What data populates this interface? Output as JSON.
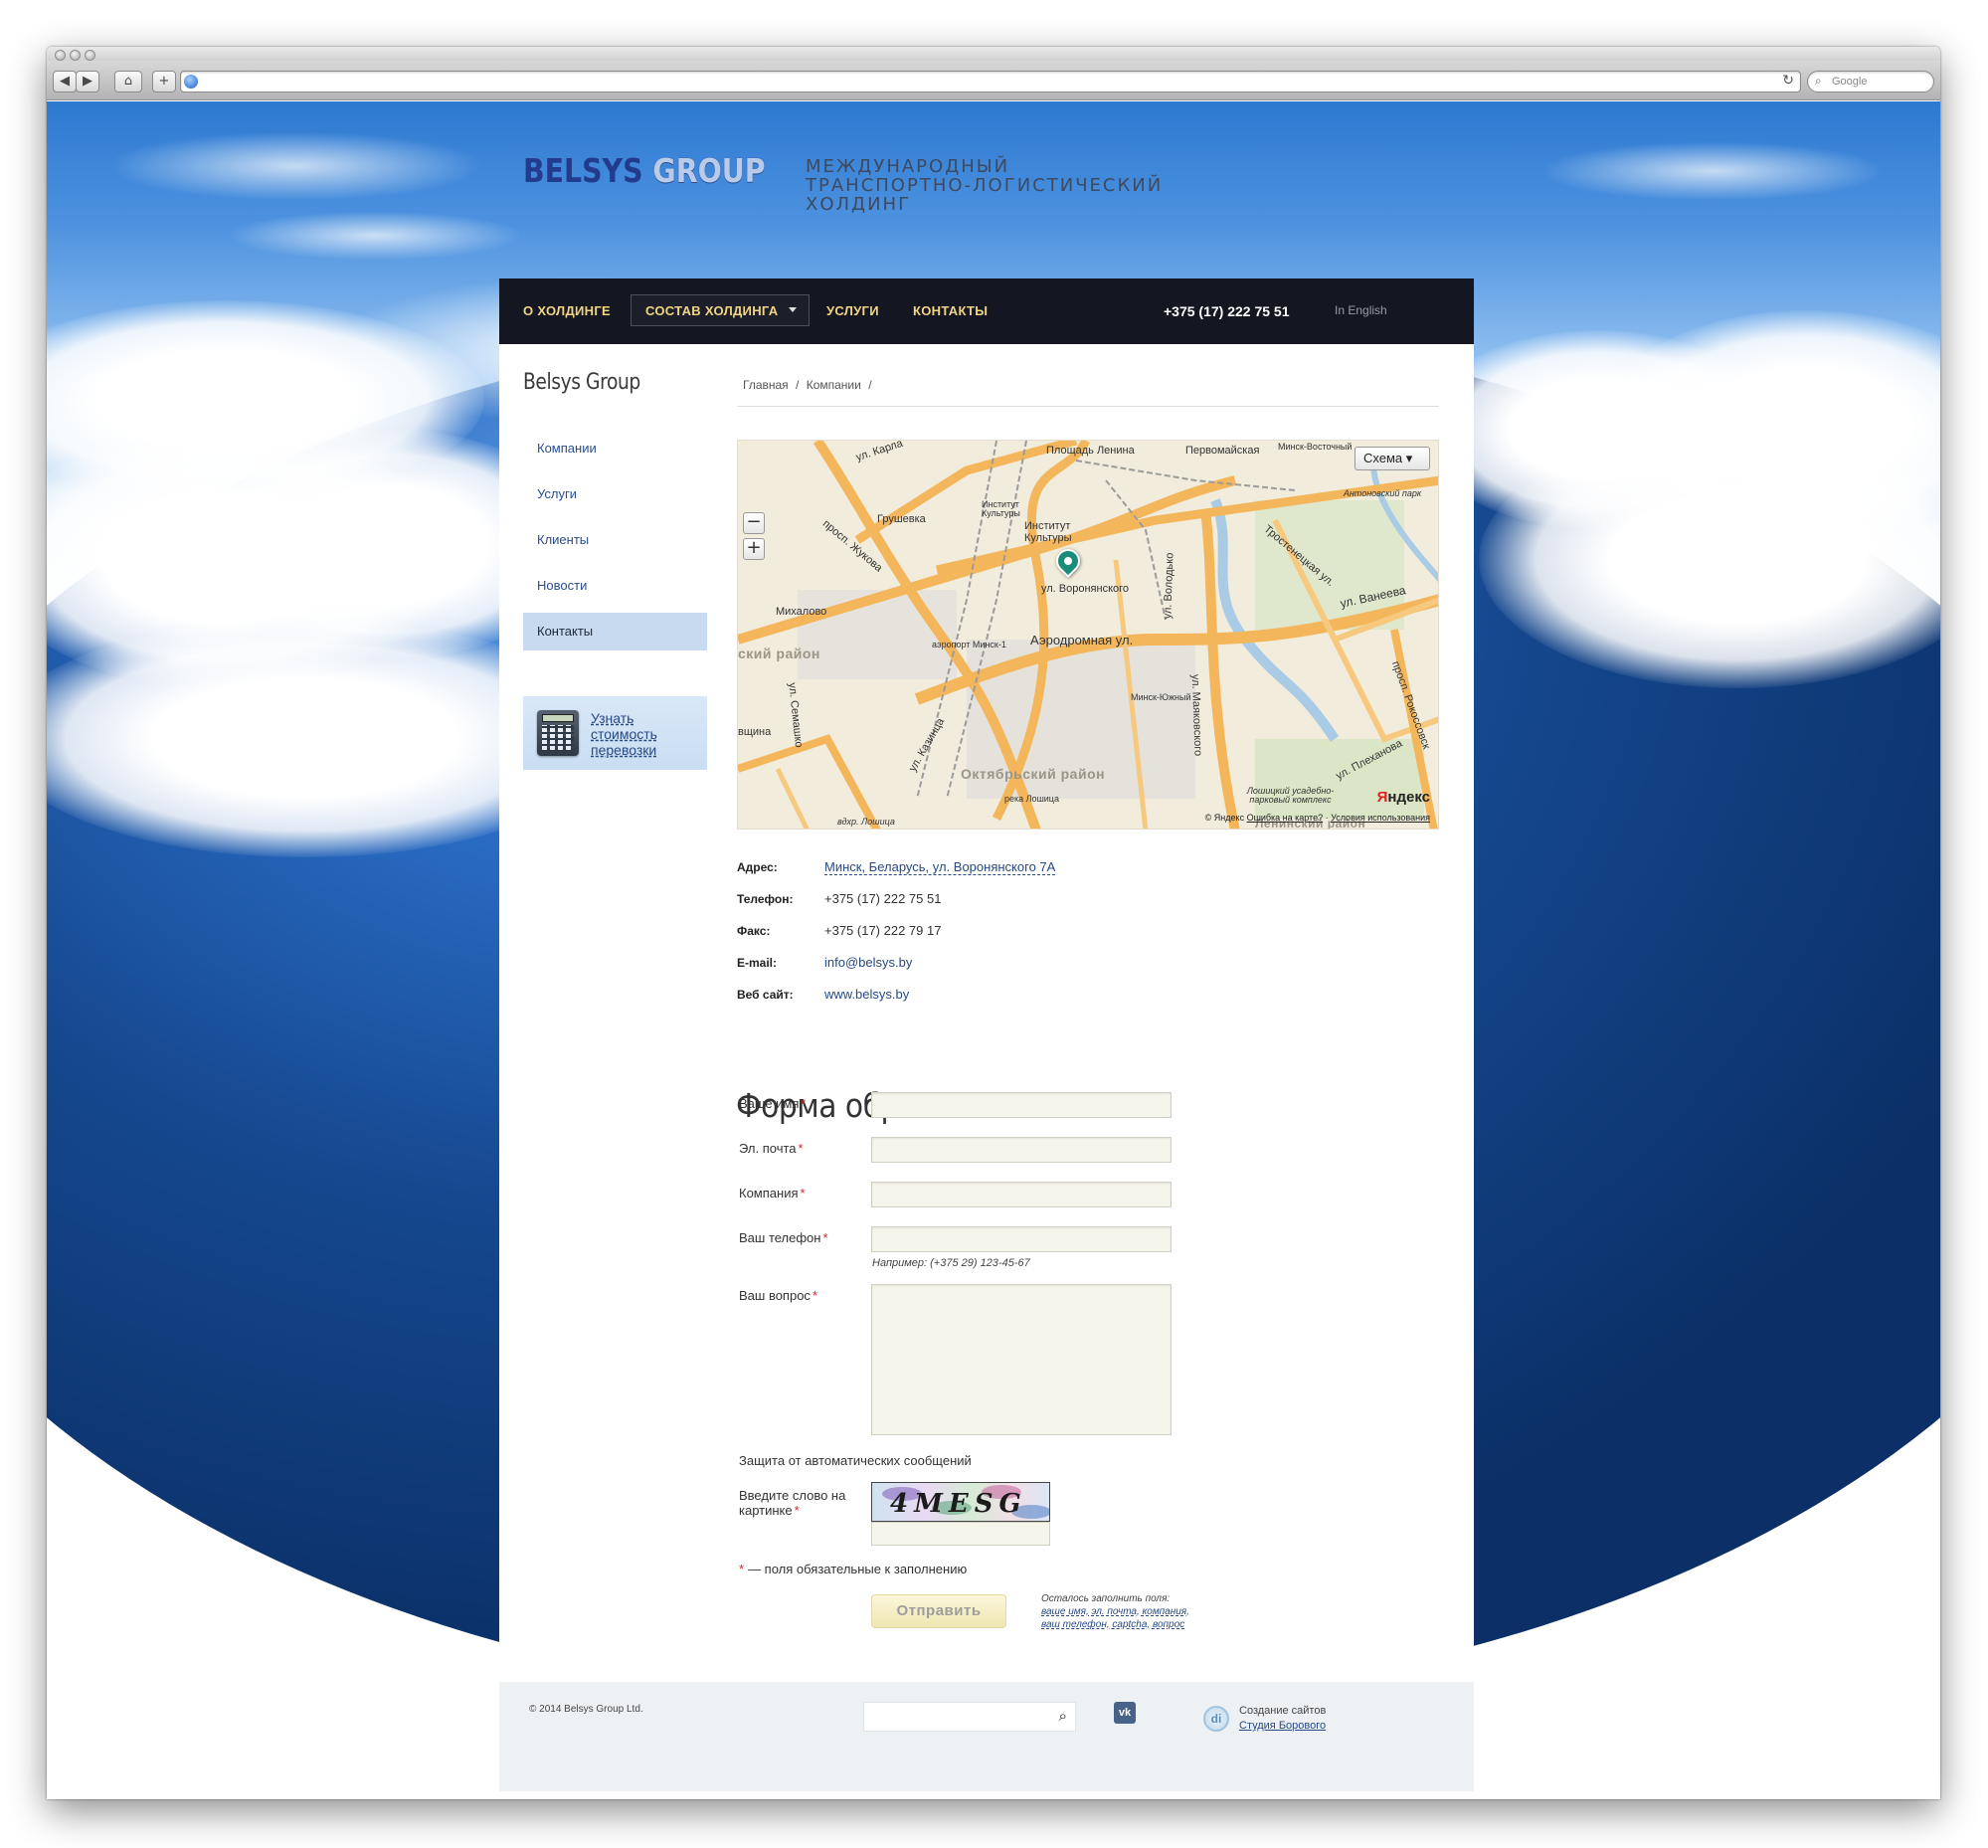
{
  "browser": {
    "search_placeholder": "Google",
    "back_icon": "back-arrow-icon",
    "forward_icon": "forward-arrow-icon",
    "home_icon": "home-icon",
    "add_icon": "plus-icon",
    "reload_icon": "reload-icon",
    "search_icon": "magnifier-icon"
  },
  "header": {
    "logo_part1": "BELSYS",
    "logo_part2": "GROUP",
    "tagline_line1": "МЕЖДУНАРОДНЫЙ",
    "tagline_line2": "ТРАНСПОРТНО-ЛОГИСТИЧЕСКИЙ",
    "tagline_line3": "ХОЛДИНГ"
  },
  "nav": {
    "items": [
      "О ХОЛДИНГЕ",
      "СОСТАВ ХОЛДИНГА",
      "УСЛУГИ",
      "КОНТАКТЫ"
    ],
    "phone": "+375 (17) 222 75 51",
    "english": "In English"
  },
  "sidebar": {
    "title": "Belsys Group",
    "items": [
      "Компании",
      "Услуги",
      "Клиенты",
      "Новости",
      "Контакты"
    ],
    "active_index": 4,
    "calc_link": "Узнать стоимость перевозки"
  },
  "breadcrumb": [
    "Главная",
    "/",
    "Компании",
    "/"
  ],
  "map": {
    "type_button": "Схема ▾",
    "zoom_minus": "−",
    "zoom_plus": "+",
    "labels": {
      "karla": "ул. Карла",
      "lenina": "Площадь Ленина",
      "pervomaiskaya": "Первомайская",
      "minsk_vost": "Минск-Восточный",
      "gruschevka": "Грушевка",
      "institut_small": "Институт Культуры",
      "institut": "Институт Культуры",
      "antonovsky": "Антоновский парк",
      "zhukova": "просп. Жукова",
      "voronyanskogo": "ул. Воронянского",
      "volodko": "ул. Володько",
      "trostenetskaya": "Тростенецкая ул.",
      "vaneeva": "ул. Ванеева",
      "mikhalovo": "Михалово",
      "airport": "аэропорт Минск-1",
      "aerodromnaya": "Аэродромная ул.",
      "district_left": "ский район",
      "minsk_yuzh": "Минск-Южный",
      "mayakovskogo": "ул. Маяковского",
      "rokossovskogo": "просп. Рокоссовск",
      "semashko": "ул. Семашко",
      "kazinza": "ул. Казинца",
      "oktyabrsky": "Октябрьский район",
      "plekhanova": "ул. Плеханова",
      "vshchina": "вщина",
      "loshitsky": "Лошицкий усадебно-парковый комплекс",
      "loshica": "река Лошица",
      "vdkhr": "вдхр. Лошица",
      "leninsky": "Ленинский район"
    },
    "brand_y": "Я",
    "brand_rest": "ндекс",
    "copyright": "© Яндекс",
    "error_link": "Ошибка на карте?",
    "terms_link": "Условия использования"
  },
  "contacts": {
    "address_label": "Адрес:",
    "address_value": "Минск, Беларусь, ул. Воронянского 7А",
    "phone_label": "Телефон:",
    "phone_value": "+375 (17) 222 75 51",
    "fax_label": "Факс:",
    "fax_value": "+375 (17) 222 79 17",
    "email_label": "E-mail:",
    "email_value": "info@belsys.by",
    "web_label": "Веб сайт:",
    "web_value": "www.belsys.by"
  },
  "form": {
    "title": "Форма обратной связи:",
    "name_label": "Ваше имя",
    "email_label": "Эл. почта",
    "company_label": "Компания",
    "phone_label": "Ваш телефон",
    "phone_hint": "Например: (+375 29) 123-45-67",
    "question_label": "Ваш вопрос",
    "required_mark": "*",
    "captcha_title": "Защита от автоматических сообщений",
    "captcha_label": "Введите слово на картинке",
    "captcha_text": "4MESG",
    "required_note": "— поля обязательные к заполнению",
    "submit": "Отправить",
    "remaining_title": "Осталось заполнить поля:",
    "remaining_fields": "ваше имя, эл. почта, компания, ваш телефон, captcha, вопрос"
  },
  "footer": {
    "copyright": "© 2014 Belsys Group Ltd.",
    "search_icon": "magnifier-icon",
    "vk": "vk",
    "studio_logo": "di",
    "studio_line1": "Создание сайтов",
    "studio_link": "Студия Борового"
  }
}
